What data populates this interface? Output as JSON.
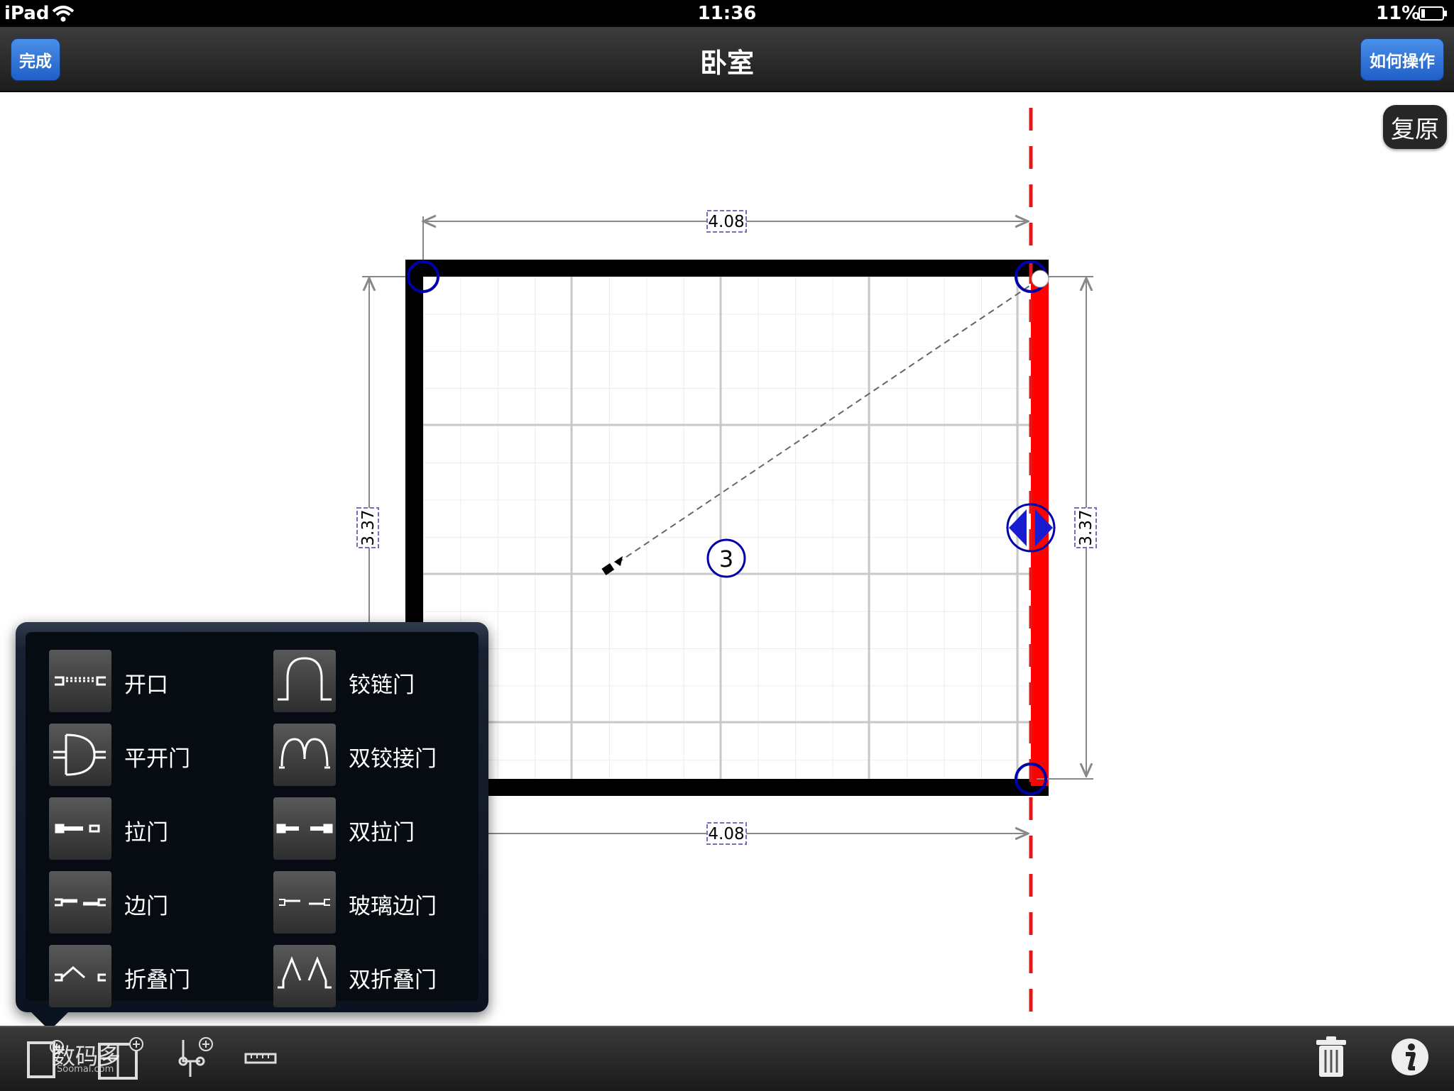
{
  "status_bar": {
    "device": "iPad",
    "time": "11:36",
    "battery": "11%"
  },
  "nav": {
    "done_label": "完成",
    "title": "卧室",
    "help_label": "如何操作"
  },
  "restore_label": "复原",
  "plan": {
    "top_width": "4.08",
    "bottom_width": "4.08",
    "left_height": "3.37",
    "right_height": "3.37",
    "room_number": "3"
  },
  "popover": {
    "items": [
      {
        "label": "开口",
        "icon": "opening-icon"
      },
      {
        "label": "铰链门",
        "icon": "hinged-door-icon"
      },
      {
        "label": "平开门",
        "icon": "swing-door-icon"
      },
      {
        "label": "双铰接门",
        "icon": "double-hinged-door-icon"
      },
      {
        "label": "拉门",
        "icon": "sliding-door-icon"
      },
      {
        "label": "双拉门",
        "icon": "double-sliding-door-icon"
      },
      {
        "label": "边门",
        "icon": "side-door-icon"
      },
      {
        "label": "玻璃边门",
        "icon": "glass-side-door-icon"
      },
      {
        "label": "折叠门",
        "icon": "folding-door-icon"
      },
      {
        "label": "双折叠门",
        "icon": "double-folding-door-icon"
      }
    ]
  },
  "toolbar": {
    "watermark": "数码多",
    "watermark_sub": "Soomal.com",
    "icons": [
      "add-door-icon",
      "add-room-icon",
      "add-point-icon",
      "ruler-icon",
      "trash-icon",
      "info-icon"
    ]
  },
  "colors": {
    "accent": "#1f5fc7",
    "selected_wall": "#ff0000",
    "handle": "#0000aa"
  }
}
